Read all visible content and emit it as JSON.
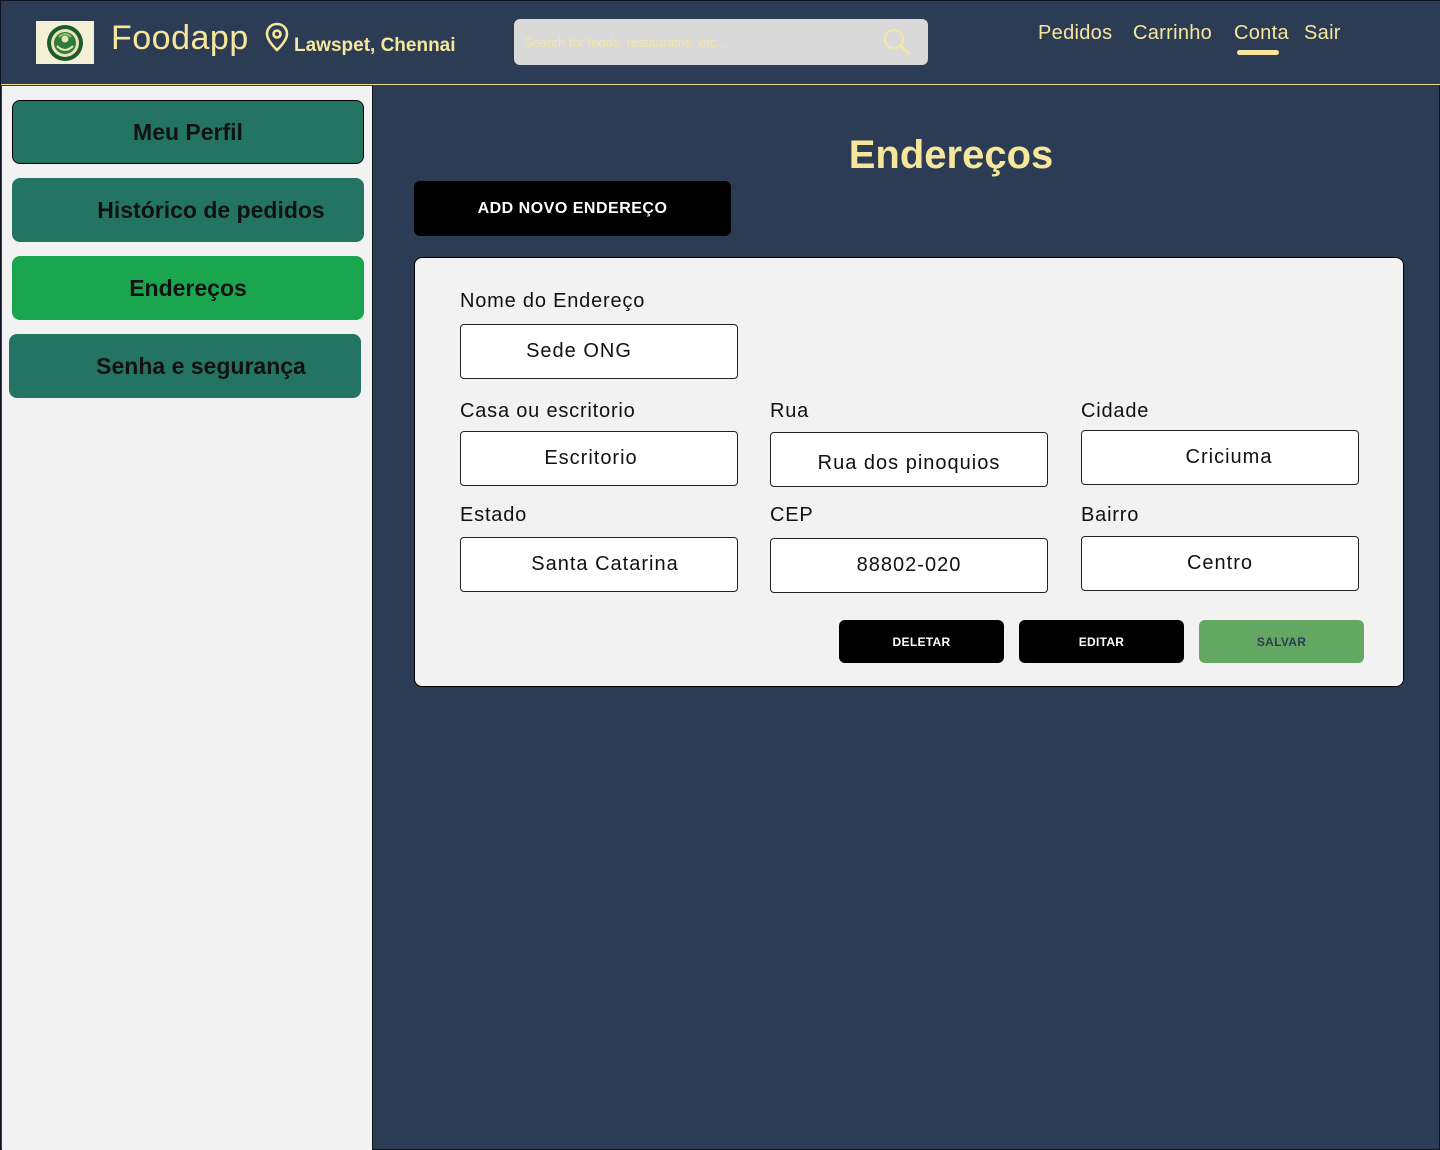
{
  "header": {
    "brand": "Foodapp",
    "location": "Lawspet, Chennai",
    "search_placeholder": "Search for foods, restauratns, etc...",
    "nav": [
      "Pedidos",
      "Carrinho",
      "Conta",
      "Sair"
    ],
    "active_nav": "Conta",
    "colors": {
      "accent": "#f7e79c",
      "background": "#2c3c55"
    }
  },
  "sidebar": {
    "items": [
      {
        "label": "Meu Perfil"
      },
      {
        "label": "Histórico de pedidos"
      },
      {
        "label": "Endereços",
        "active": true
      },
      {
        "label": "Senha e segurança"
      }
    ],
    "colors": {
      "item": "#247464",
      "active": "#1aa64f"
    }
  },
  "main": {
    "title": "Endereços",
    "add_button": "ADD NOVO ENDEREÇO",
    "form": {
      "nome": {
        "label": "Nome do Endereço",
        "value": "Sede ONG"
      },
      "tipo": {
        "label": "Casa ou escritorio",
        "value": "Escritorio"
      },
      "rua": {
        "label": "Rua",
        "value": "Rua dos pinoquios"
      },
      "cidade": {
        "label": "Cidade",
        "value": "Criciuma"
      },
      "estado": {
        "label": "Estado",
        "value": "Santa Catarina"
      },
      "cep": {
        "label": "CEP",
        "value": "88802-020"
      },
      "bairro": {
        "label": "Bairro",
        "value": "Centro"
      }
    },
    "actions": {
      "delete": "DELETAR",
      "edit": "EDITAR",
      "save": "SALVAR"
    }
  }
}
